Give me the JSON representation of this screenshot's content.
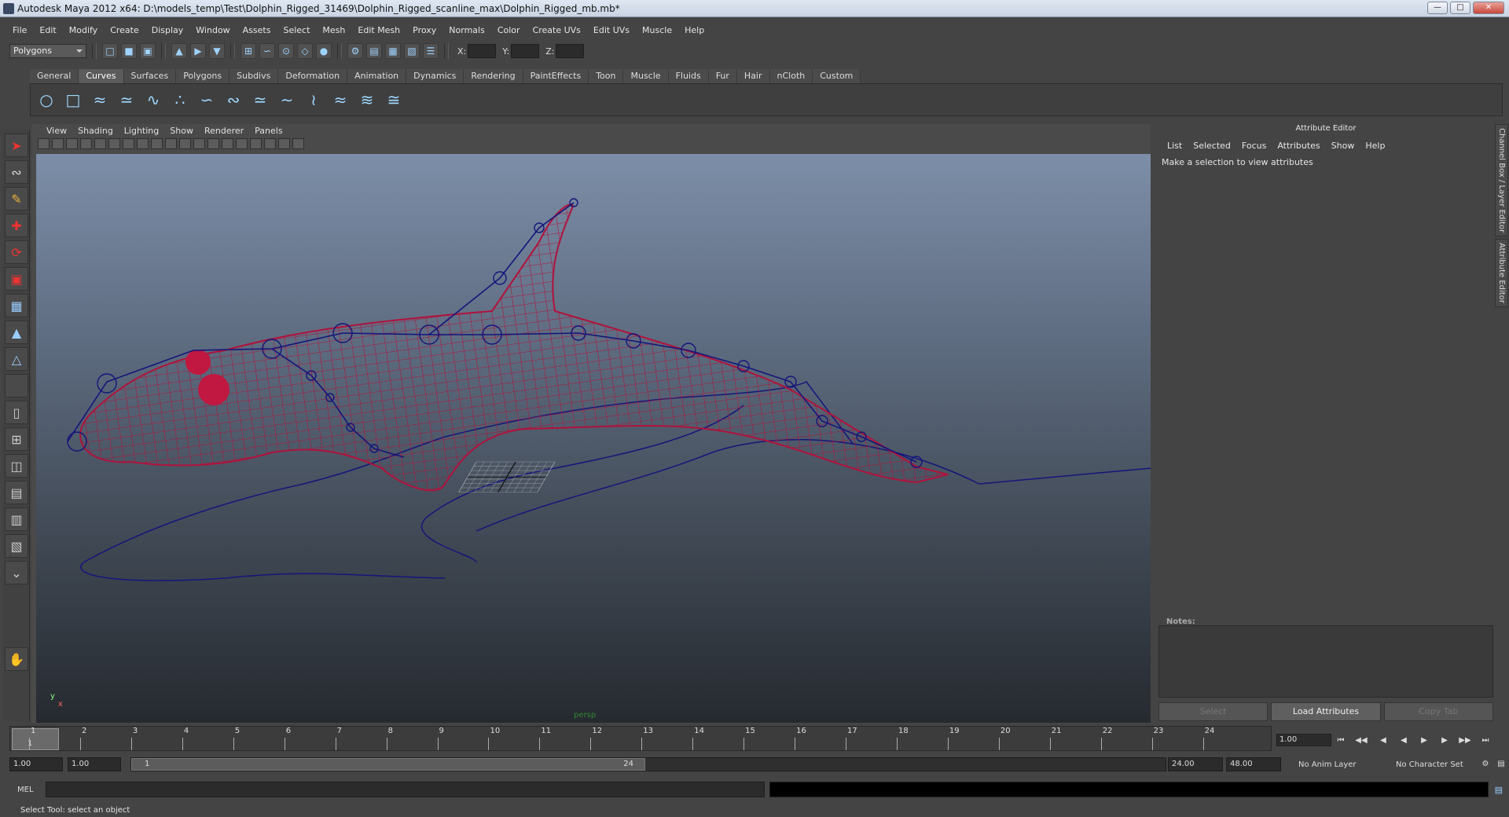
{
  "window": {
    "title": "Autodesk Maya 2012 x64: D:\\models_temp\\Test\\Dolphin_Rigged_31469\\Dolphin_Rigged_scanline_max\\Dolphin_Rigged_mb.mb*"
  },
  "menubar": {
    "items": [
      "File",
      "Edit",
      "Modify",
      "Create",
      "Display",
      "Window",
      "Assets",
      "Select",
      "Mesh",
      "Edit Mesh",
      "Proxy",
      "Normals",
      "Color",
      "Create UVs",
      "Edit UVs",
      "Muscle",
      "Help"
    ]
  },
  "statusline": {
    "mode": "Polygons",
    "x_label": "X:",
    "y_label": "Y:",
    "z_label": "Z:"
  },
  "shelf": {
    "tabs": [
      "General",
      "Curves",
      "Surfaces",
      "Polygons",
      "Subdivs",
      "Deformation",
      "Animation",
      "Dynamics",
      "Rendering",
      "PaintEffects",
      "Toon",
      "Muscle",
      "Fluids",
      "Fur",
      "Hair",
      "nCloth",
      "Custom"
    ],
    "active": "Curves"
  },
  "viewport": {
    "menu": [
      "View",
      "Shading",
      "Lighting",
      "Show",
      "Renderer",
      "Panels"
    ],
    "camera": "persp",
    "axis_y": "y",
    "axis_x": "x"
  },
  "attribute_editor": {
    "title": "Attribute Editor",
    "menu": [
      "List",
      "Selected",
      "Focus",
      "Attributes",
      "Show",
      "Help"
    ],
    "message": "Make a selection to view attributes",
    "notes_label": "Notes:",
    "buttons": [
      "Select",
      "Load Attributes",
      "Copy Tab"
    ]
  },
  "side_tabs": [
    "Channel Box / Layer Editor",
    "Attribute Editor"
  ],
  "timeline": {
    "ticks": [
      "1",
      "2",
      "3",
      "4",
      "5",
      "6",
      "7",
      "8",
      "9",
      "10",
      "11",
      "12",
      "13",
      "14",
      "15",
      "16",
      "17",
      "18",
      "19",
      "20",
      "21",
      "22",
      "23",
      "24"
    ],
    "current_frame": "1",
    "current_time": "1.00"
  },
  "range": {
    "start": "1.00",
    "playback_start": "1.00",
    "slider_start": "1",
    "slider_end": "24",
    "playback_end": "24.00",
    "end": "48.00",
    "anim_layer": "No Anim Layer",
    "character_set": "No Character Set"
  },
  "command": {
    "label": "MEL"
  },
  "help_line": "Select Tool: select an object",
  "colors": {
    "wire": "#b0123c",
    "joint": "#1a1a8a",
    "bg": "#444444"
  }
}
